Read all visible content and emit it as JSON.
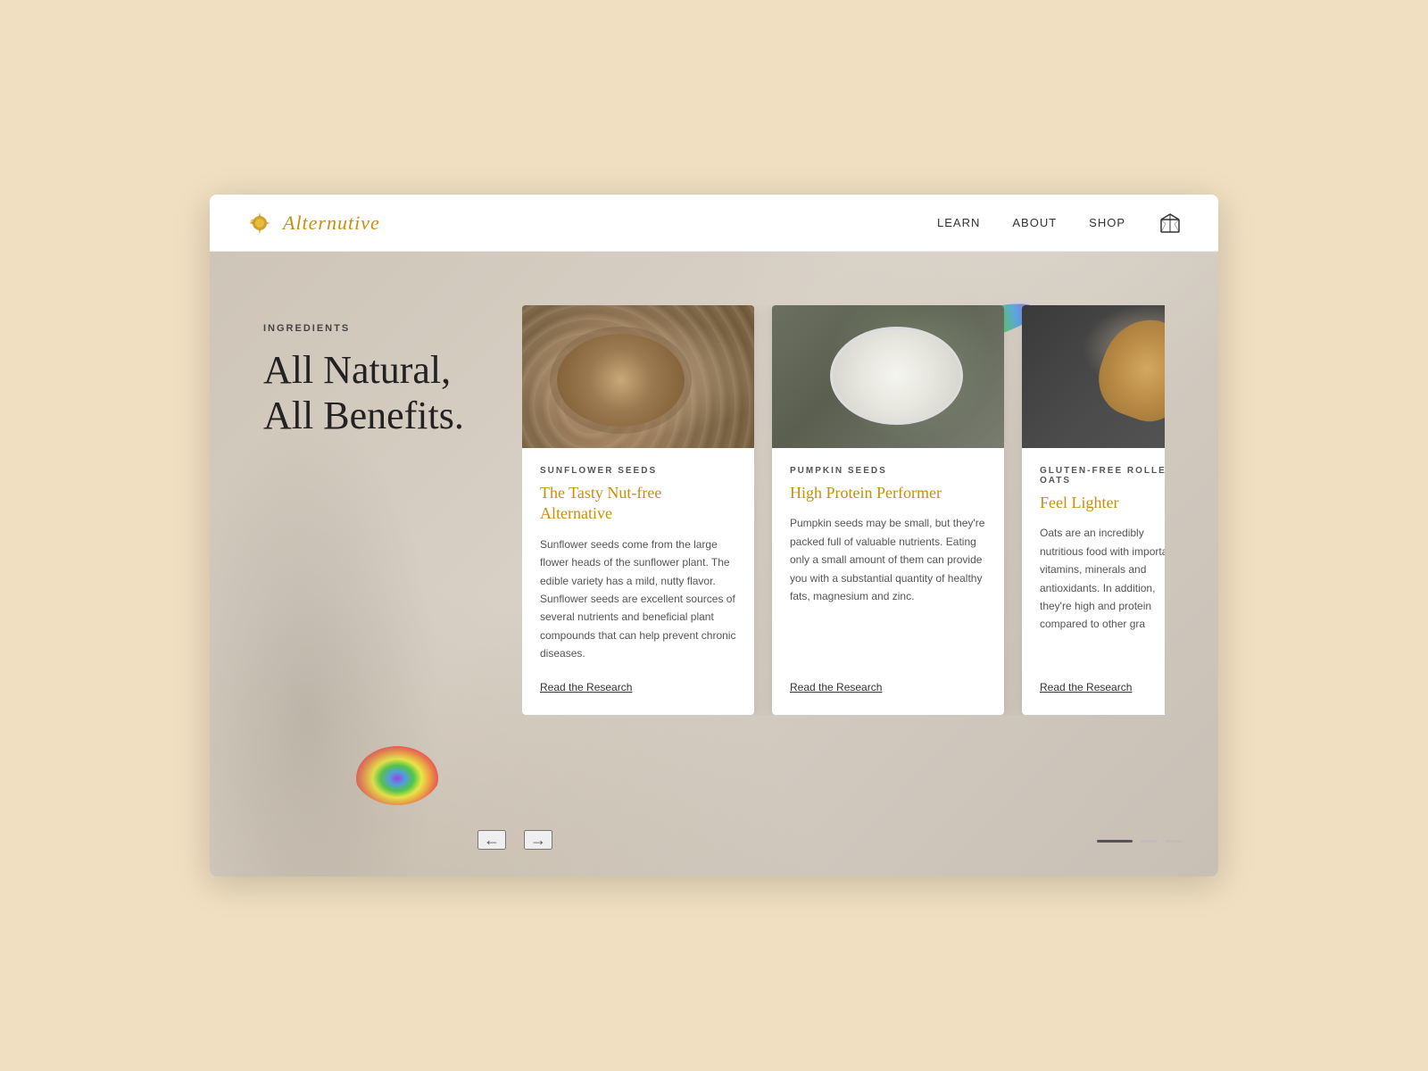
{
  "nav": {
    "logo_text": "Alternutive",
    "links": [
      "LEARN",
      "ABOUT",
      "SHOP"
    ],
    "cart_icon": "cube-icon"
  },
  "hero": {
    "section_label": "INGREDIENTS",
    "title_line1": "All Natural,",
    "title_line2": "All Benefits."
  },
  "cards": [
    {
      "category": "SUNFLOWER SEEDS",
      "title": "The Tasty Nut-free Alternative",
      "description": "Sunflower seeds come from the large flower heads of the sunflower plant. The edible variety has a mild, nutty flavor. Sunflower seeds are excellent sources of several nutrients and beneficial plant compounds that can help prevent chronic diseases.",
      "link_label": "Read the Research",
      "image_type": "sunflower"
    },
    {
      "category": "PUMPKIN SEEDS",
      "title": "High Protein Performer",
      "description": "Pumpkin seeds may be small, but they're packed full of valuable nutrients. Eating only a small amount of them can provide you with a substantial quantity of healthy fats, magnesium and zinc.",
      "link_label": "Read the Research",
      "image_type": "pumpkin"
    },
    {
      "category": "GLUTEN-FREE ROLLED OATS",
      "title": "Feel Lighter",
      "description": "Oats are an incredibly nutritious food with important vitamins, minerals and antioxidants. In addition, they're high and protein compared to other gra",
      "link_label": "Read the Research",
      "image_type": "oats"
    }
  ],
  "slider": {
    "prev_label": "←",
    "next_label": "→",
    "dots": [
      "active",
      "inactive",
      "inactive"
    ]
  }
}
